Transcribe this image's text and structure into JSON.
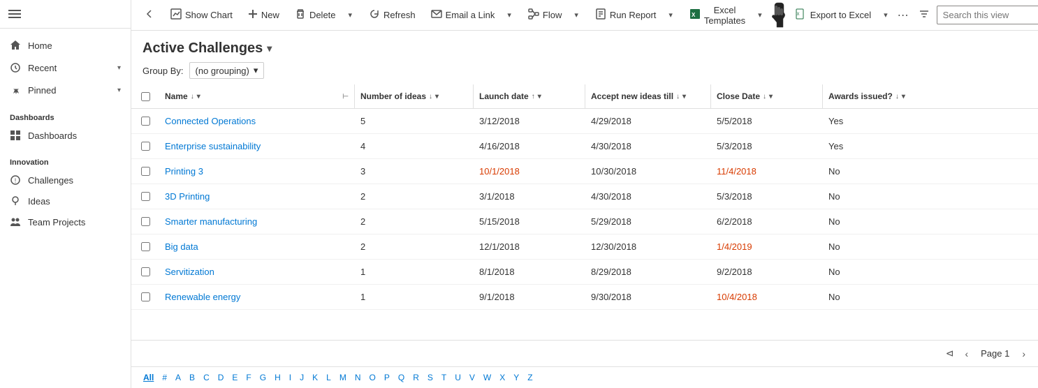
{
  "sidebar": {
    "nav_items": [
      {
        "id": "home",
        "label": "Home",
        "icon": "home"
      },
      {
        "id": "recent",
        "label": "Recent",
        "icon": "recent",
        "has_chevron": true
      },
      {
        "id": "pinned",
        "label": "Pinned",
        "icon": "pin",
        "has_chevron": true
      }
    ],
    "sections": [
      {
        "id": "dashboards",
        "label": "Dashboards",
        "items": [
          {
            "id": "dashboards-item",
            "label": "Dashboards",
            "icon": "dashboard"
          }
        ]
      },
      {
        "id": "innovation",
        "label": "Innovation",
        "items": [
          {
            "id": "challenges",
            "label": "Challenges",
            "icon": "challenge"
          },
          {
            "id": "ideas",
            "label": "Ideas",
            "icon": "ideas"
          },
          {
            "id": "team-projects",
            "label": "Team Projects",
            "icon": "team"
          }
        ]
      }
    ]
  },
  "toolbar": {
    "back_label": "←",
    "show_chart_label": "Show Chart",
    "new_label": "New",
    "delete_label": "Delete",
    "refresh_label": "Refresh",
    "email_link_label": "Email a Link",
    "flow_label": "Flow",
    "run_report_label": "Run Report",
    "excel_templates_label": "Excel Templates",
    "export_to_excel_label": "Export to Excel",
    "more_label": "⋯"
  },
  "header": {
    "title": "Active Challenges",
    "search_placeholder": "Search this view"
  },
  "group_by": {
    "label": "Group By:",
    "value": "(no grouping)"
  },
  "columns": {
    "name": "Name",
    "ideas": "Number of ideas",
    "launch": "Launch date",
    "accept": "Accept new ideas till",
    "close": "Close Date",
    "awards": "Awards issued?"
  },
  "rows": [
    {
      "name": "Connected Operations",
      "ideas": "5",
      "launch": "3/12/2018",
      "accept": "4/29/2018",
      "close": "5/5/2018",
      "awards": "Yes",
      "launch_orange": false,
      "close_orange": false,
      "accept_orange": false
    },
    {
      "name": "Enterprise sustainability",
      "ideas": "4",
      "launch": "4/16/2018",
      "accept": "4/30/2018",
      "close": "5/3/2018",
      "awards": "Yes",
      "launch_orange": false,
      "close_orange": false,
      "accept_orange": false
    },
    {
      "name": "Printing 3",
      "ideas": "3",
      "launch": "10/1/2018",
      "accept": "10/30/2018",
      "close": "11/4/2018",
      "awards": "No",
      "launch_orange": true,
      "close_orange": true,
      "accept_orange": false
    },
    {
      "name": "3D Printing",
      "ideas": "2",
      "launch": "3/1/2018",
      "accept": "4/30/2018",
      "close": "5/3/2018",
      "awards": "No",
      "launch_orange": false,
      "close_orange": false,
      "accept_orange": false
    },
    {
      "name": "Smarter manufacturing",
      "ideas": "2",
      "launch": "5/15/2018",
      "accept": "5/29/2018",
      "close": "6/2/2018",
      "awards": "No",
      "launch_orange": false,
      "close_orange": false,
      "accept_orange": false
    },
    {
      "name": "Big data",
      "ideas": "2",
      "launch": "12/1/2018",
      "accept": "12/30/2018",
      "close": "1/4/2019",
      "awards": "No",
      "launch_orange": false,
      "close_orange": true,
      "accept_orange": false
    },
    {
      "name": "Servitization",
      "ideas": "1",
      "launch": "8/1/2018",
      "accept": "8/29/2018",
      "close": "9/2/2018",
      "awards": "No",
      "launch_orange": false,
      "close_orange": false,
      "accept_orange": false
    },
    {
      "name": "Renewable energy",
      "ideas": "1",
      "launch": "9/1/2018",
      "accept": "9/30/2018",
      "close": "10/4/2018",
      "awards": "No",
      "launch_orange": false,
      "close_orange": true,
      "accept_orange": false
    }
  ],
  "pagination": {
    "page_label": "Page 1"
  },
  "alpha_nav": [
    "All",
    "#",
    "A",
    "B",
    "C",
    "D",
    "E",
    "F",
    "G",
    "H",
    "I",
    "J",
    "K",
    "L",
    "M",
    "N",
    "O",
    "P",
    "Q",
    "R",
    "S",
    "T",
    "U",
    "V",
    "W",
    "X",
    "Y",
    "Z"
  ],
  "alpha_active": "All"
}
